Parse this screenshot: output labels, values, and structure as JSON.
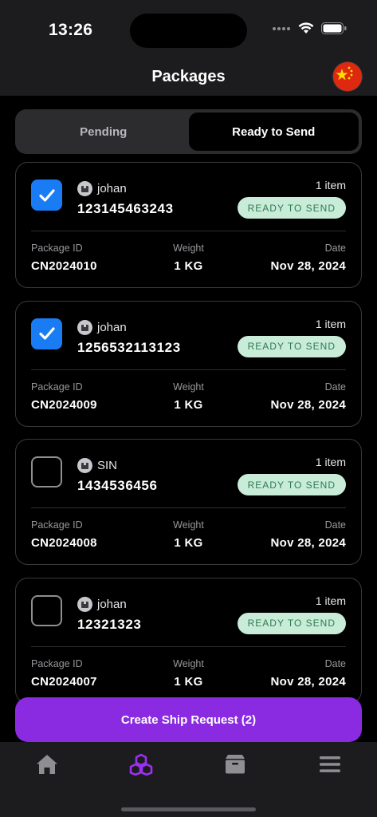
{
  "status_bar": {
    "time": "13:26"
  },
  "header": {
    "title": "Packages",
    "flag_icon": "china-flag-icon"
  },
  "tabs": [
    {
      "label": "Pending",
      "active": false
    },
    {
      "label": "Ready to Send",
      "active": true
    }
  ],
  "labels": {
    "package_id": "Package ID",
    "weight": "Weight",
    "date": "Date"
  },
  "packages": [
    {
      "checked": true,
      "user": "johan",
      "tracking": "123145463243",
      "items": "1 item",
      "status": "READY TO SEND",
      "package_id": "CN2024010",
      "weight": "1 KG",
      "date": "Nov 28, 2024"
    },
    {
      "checked": true,
      "user": "johan",
      "tracking": "1256532113123",
      "items": "1 item",
      "status": "READY TO SEND",
      "package_id": "CN2024009",
      "weight": "1 KG",
      "date": "Nov 28, 2024"
    },
    {
      "checked": false,
      "user": "SIN",
      "tracking": "1434536456",
      "items": "1 item",
      "status": "READY TO SEND",
      "package_id": "CN2024008",
      "weight": "1 KG",
      "date": "Nov 28, 2024"
    },
    {
      "checked": false,
      "user": "johan",
      "tracking": "12321323",
      "items": "1 item",
      "status": "READY TO SEND",
      "package_id": "CN2024007",
      "weight": "1 KG",
      "date": "Nov 28, 2024"
    }
  ],
  "cta": {
    "label": "Create Ship Request (2)"
  },
  "tab_bar": [
    {
      "icon": "home-icon",
      "active": false
    },
    {
      "icon": "cubes-icon",
      "active": true
    },
    {
      "icon": "box-icon",
      "active": false
    },
    {
      "icon": "menu-icon",
      "active": false
    }
  ],
  "colors": {
    "accent": "#8a2be2",
    "checkbox": "#1a7cf5",
    "status_badge_bg": "#c8ecd8",
    "status_badge_text": "#2f7a52",
    "tab_inactive": "#8e8e93"
  }
}
